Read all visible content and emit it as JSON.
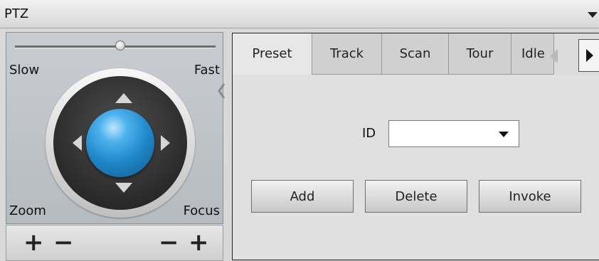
{
  "window": {
    "title": "PTZ",
    "collapse_icon": "triangle-down-icon"
  },
  "ptz_control": {
    "speed": {
      "slow_label": "Slow",
      "fast_label": "Fast",
      "level": 0.52
    },
    "joystick": {
      "up_icon": "triangle-up-icon",
      "down_icon": "triangle-down-icon",
      "left_icon": "triangle-left-icon",
      "right_icon": "triangle-right-icon",
      "ball_color": "#1f86c9"
    },
    "zoom_label": "Zoom",
    "focus_label": "Focus",
    "zoom_in": "+",
    "zoom_out": "−",
    "focus_out": "−",
    "focus_in": "+"
  },
  "tabs": [
    {
      "label": "Preset",
      "active": true
    },
    {
      "label": "Track",
      "active": false
    },
    {
      "label": "Scan",
      "active": false
    },
    {
      "label": "Tour",
      "active": false
    },
    {
      "label": "Idle",
      "active": false
    }
  ],
  "preset": {
    "id_label": "ID",
    "id_value": "",
    "add_label": "Add",
    "delete_label": "Delete",
    "invoke_label": "Invoke"
  }
}
